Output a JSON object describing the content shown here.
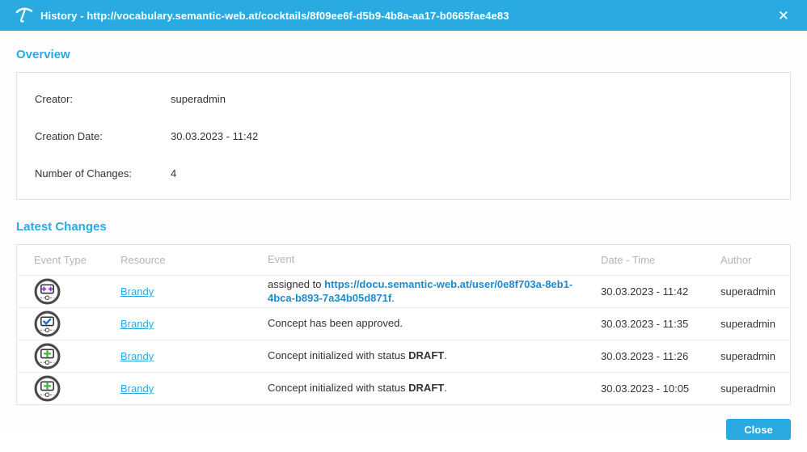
{
  "colors": {
    "accent": "#29abe2",
    "event_link": "#1e8bca",
    "icon_ring": "#4a4a4a",
    "icon_assigned": "#9b30d9",
    "icon_approved": "#1a6fd4",
    "icon_created": "#3fb83f"
  },
  "header": {
    "title": "History - http://vocabulary.semantic-web.at/cocktails/8f09ee6f-d5b9-4b8a-aa17-b0665fae4e83",
    "close_icon": "✕",
    "logo_icon": "umbrella-icon"
  },
  "overview": {
    "heading": "Overview",
    "fields": [
      {
        "label": "Creator:",
        "value": "superadmin"
      },
      {
        "label": "Creation Date:",
        "value": "30.03.2023 - 11:42"
      },
      {
        "label": "Number of Changes:",
        "value": "4"
      }
    ]
  },
  "latest_changes": {
    "heading": "Latest Changes",
    "columns": [
      "Event Type",
      "Resource",
      "Event",
      "Date - Time",
      "Author"
    ],
    "rows": [
      {
        "icon": "assigned",
        "resource": "Brandy",
        "event_prefix": "assigned to ",
        "event_link": "https://docu.semantic-web.at/user/0e8f703a-8eb1-4bca-b893-7a34b05d871f",
        "event_bold": "",
        "event_suffix": ".",
        "date": "30.03.2023 - 11:42",
        "author": "superadmin"
      },
      {
        "icon": "approved",
        "resource": "Brandy",
        "event_prefix": "Concept has been approved.",
        "event_link": "",
        "event_bold": "",
        "event_suffix": "",
        "date": "30.03.2023 - 11:35",
        "author": "superadmin"
      },
      {
        "icon": "created",
        "resource": "Brandy",
        "event_prefix": "Concept initialized with status ",
        "event_link": "",
        "event_bold": "DRAFT",
        "event_suffix": ".",
        "date": "30.03.2023 - 11:26",
        "author": "superadmin"
      },
      {
        "icon": "created",
        "resource": "Brandy",
        "event_prefix": "Concept initialized with status ",
        "event_link": "",
        "event_bold": "DRAFT",
        "event_suffix": ".",
        "date": "30.03.2023 - 10:05",
        "author": "superadmin"
      }
    ]
  },
  "footer": {
    "close_button": "Close"
  }
}
